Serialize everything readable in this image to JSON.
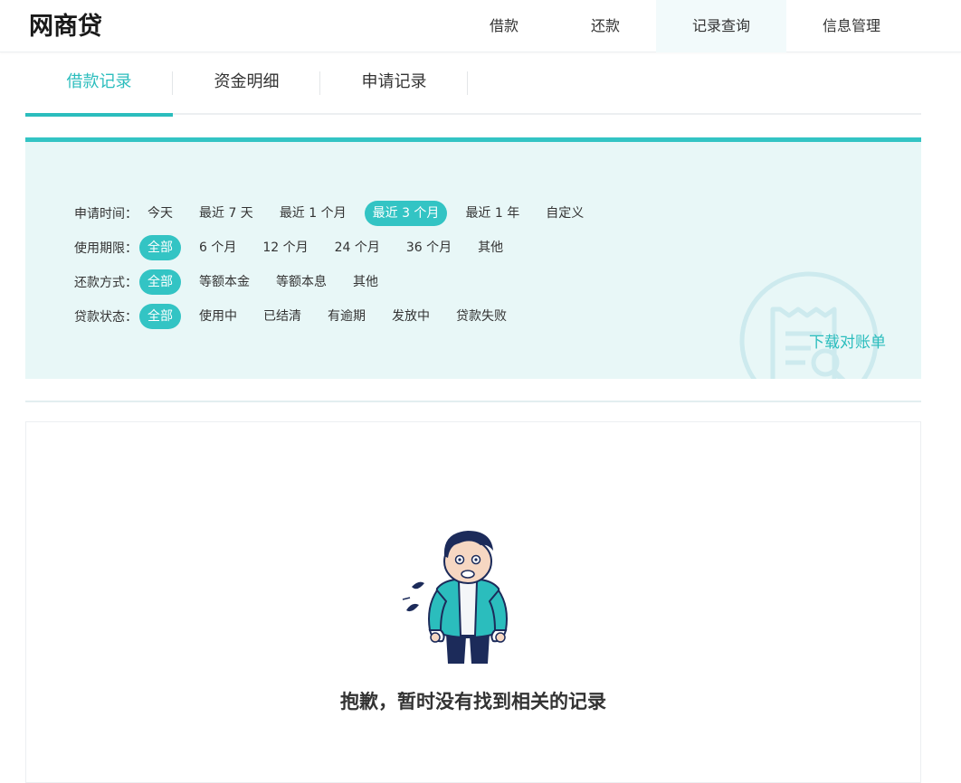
{
  "header": {
    "logo": "网商贷",
    "nav": [
      {
        "label": "借款",
        "active": false
      },
      {
        "label": "还款",
        "active": false
      },
      {
        "label": "记录查询",
        "active": true
      },
      {
        "label": "信息管理",
        "active": false
      }
    ]
  },
  "tabs": [
    {
      "label": "借款记录",
      "active": true
    },
    {
      "label": "资金明细",
      "active": false
    },
    {
      "label": "申请记录",
      "active": false
    }
  ],
  "filters": [
    {
      "label": "申请时间：",
      "options": [
        "今天",
        "最近 7 天",
        "最近 1 个月",
        "最近 3 个月",
        "最近 1 年",
        "自定义"
      ],
      "selected": 3
    },
    {
      "label": "使用期限：",
      "options": [
        "全部",
        "6 个月",
        "12 个月",
        "24 个月",
        "36 个月",
        "其他"
      ],
      "selected": 0
    },
    {
      "label": "还款方式：",
      "options": [
        "全部",
        "等额本金",
        "等额本息",
        "其他"
      ],
      "selected": 0
    },
    {
      "label": "贷款状态：",
      "options": [
        "全部",
        "使用中",
        "已结清",
        "有逾期",
        "发放中",
        "贷款失败"
      ],
      "selected": 0
    }
  ],
  "download_label": "下载对账单",
  "empty_message": "抱歉，暂时没有找到相关的记录",
  "icons": {
    "bill": "bill-icon",
    "empty": "empty-pockets-illustration"
  },
  "colors": {
    "accent": "#33c4c4",
    "accent_text": "#2bbdbd",
    "panel_bg": "#e8f7f7",
    "nav_active_bg": "#f2fafb"
  }
}
